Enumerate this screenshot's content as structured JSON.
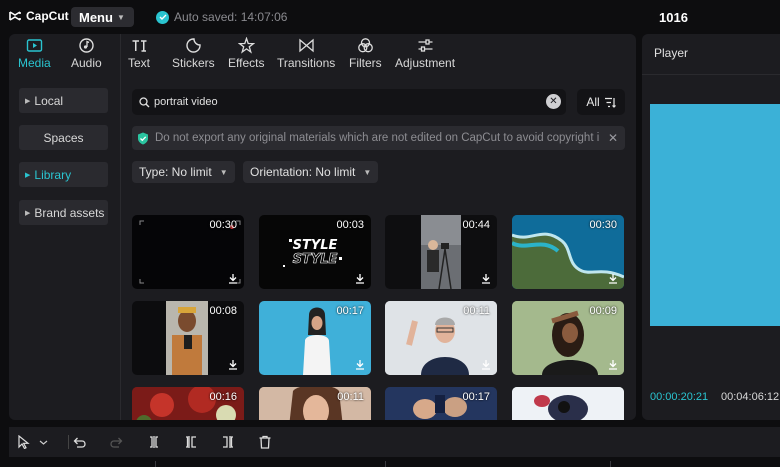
{
  "app": {
    "logo_text": "CapCut",
    "menu_label": "Menu",
    "autosave_text": "Auto saved: 14:07:06",
    "project_title": "1016"
  },
  "tabs": [
    {
      "label": "Media",
      "icon": "media-icon"
    },
    {
      "label": "Audio",
      "icon": "audio-icon"
    },
    {
      "label": "Text",
      "icon": "text-icon"
    },
    {
      "label": "Stickers",
      "icon": "sticker-icon"
    },
    {
      "label": "Effects",
      "icon": "effects-icon"
    },
    {
      "label": "Transitions",
      "icon": "transitions-icon"
    },
    {
      "label": "Filters",
      "icon": "filters-icon"
    },
    {
      "label": "Adjustment",
      "icon": "adjustment-icon"
    }
  ],
  "active_tab": "Media",
  "sidebar": {
    "items": [
      {
        "label": "Local"
      },
      {
        "label": "Spaces"
      },
      {
        "label": "Library"
      },
      {
        "label": "Brand assets"
      }
    ],
    "active": "Library"
  },
  "search": {
    "value": "portrait video"
  },
  "filter_all_label": "All",
  "notice": "Do not export any original materials which are not edited on CapCut to avoid copyright i",
  "filters": {
    "type": "Type: No limit",
    "orientation": "Orientation: No limit"
  },
  "library": {
    "tiles": [
      {
        "duration": "00:30",
        "scene": "dark-frame"
      },
      {
        "duration": "00:03",
        "scene": "style-text"
      },
      {
        "duration": "00:44",
        "scene": "person-tripod"
      },
      {
        "duration": "00:30",
        "scene": "coast"
      },
      {
        "duration": "00:08",
        "scene": "person-phone"
      },
      {
        "duration": "00:17",
        "scene": "woman-blue"
      },
      {
        "duration": "00:11",
        "scene": "man-waving"
      },
      {
        "duration": "00:09",
        "scene": "woman-saluting"
      },
      {
        "duration": "00:16",
        "scene": "red-flowers"
      },
      {
        "duration": "00:11",
        "scene": "woman-portrait"
      },
      {
        "duration": "00:17",
        "scene": "hands"
      },
      {
        "duration": "",
        "scene": "camera"
      }
    ],
    "style_text": "STYLE"
  },
  "player": {
    "title": "Player",
    "current_time": "00:00:20:21",
    "total_time": "00:04:06:12"
  },
  "colors": {
    "accent": "#2ac4d0",
    "panel": "#1c1c20",
    "background": "#0d0d0f",
    "player_screen": "#3bb1d7"
  },
  "toolbar_icons": [
    "select-icon",
    "undo-icon",
    "redo-icon",
    "split-icon",
    "split-left-icon",
    "split-right-icon",
    "delete-icon"
  ]
}
